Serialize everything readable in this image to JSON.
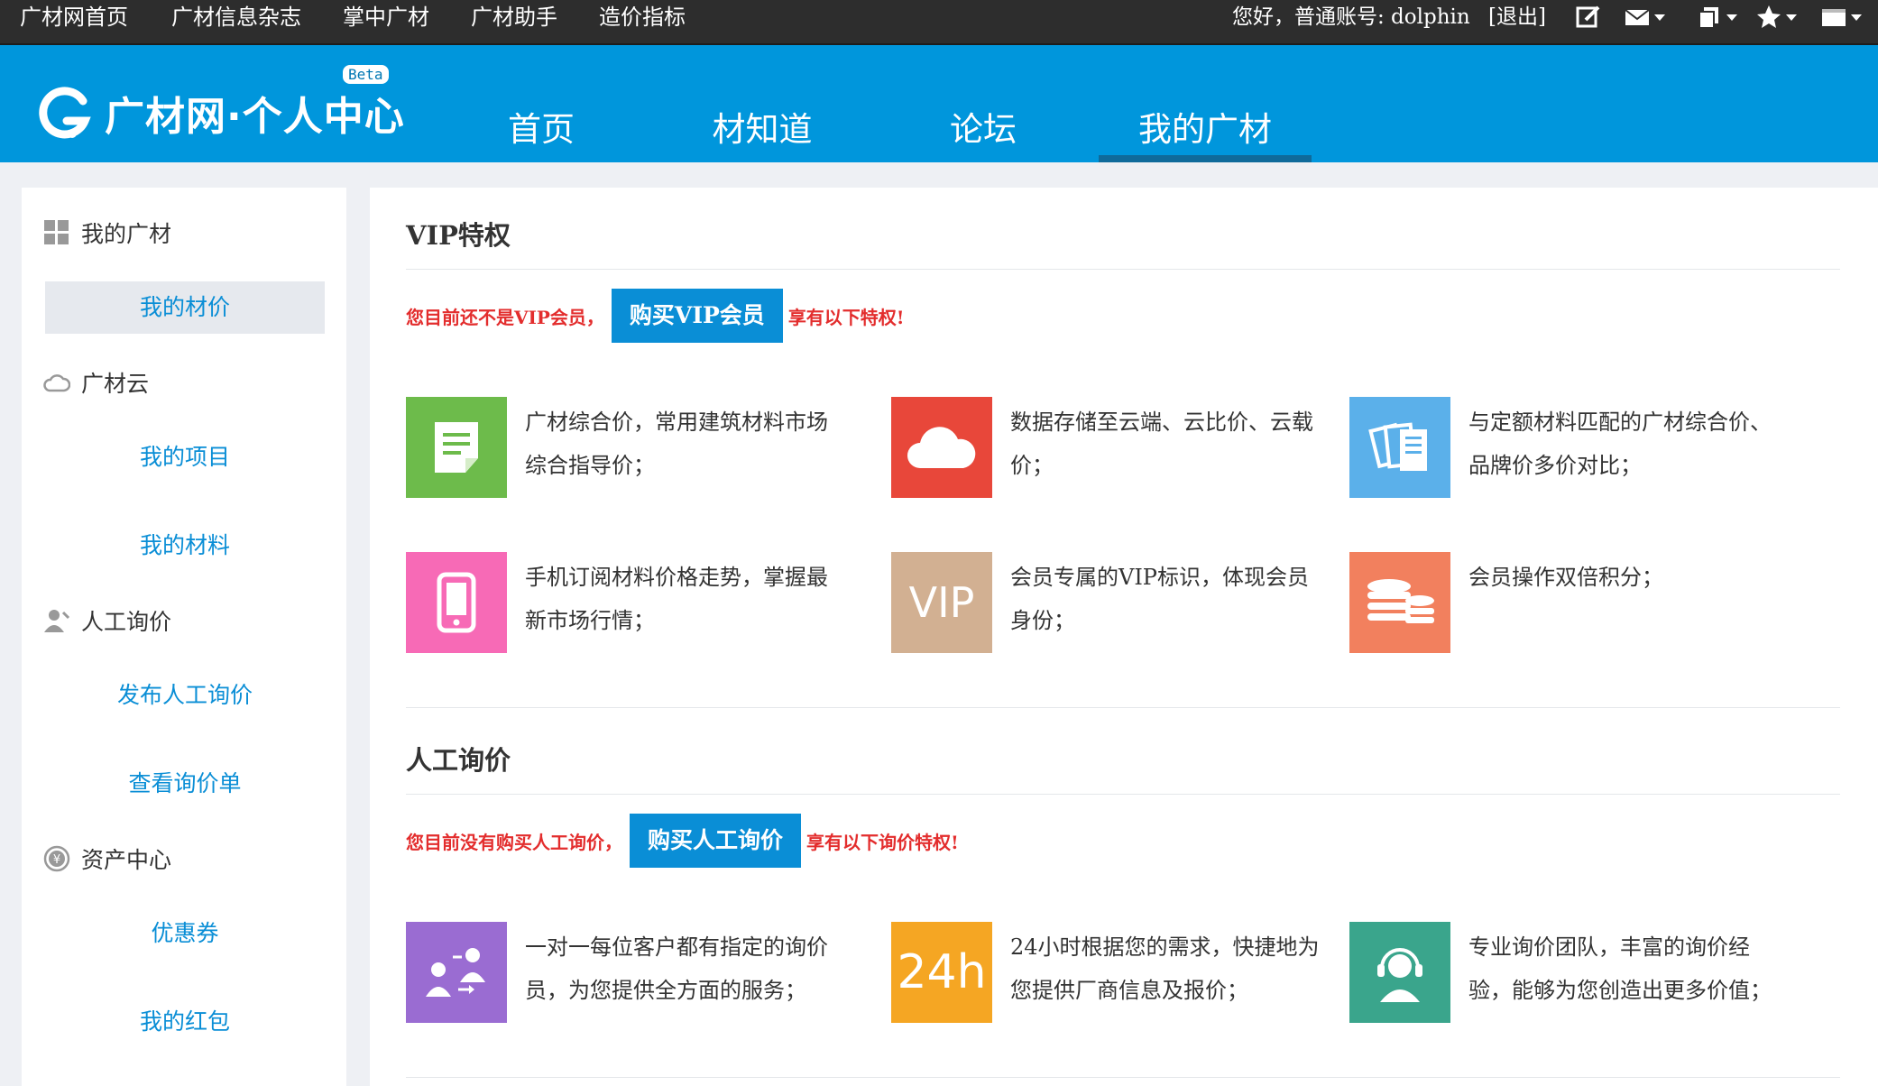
{
  "topbar": {
    "links": [
      "广材网首页",
      "广材信息杂志",
      "掌中广材",
      "广材助手",
      "造价指标"
    ],
    "greeting": "您好，普通账号: dolphin",
    "logout": "[退出]",
    "icons": [
      "edit-icon",
      "mail-icon",
      "copy-icon",
      "star-icon",
      "window-icon"
    ]
  },
  "header": {
    "logo_text": "广材网·个人中心",
    "beta": "Beta",
    "nav": [
      "首页",
      "材知道",
      "论坛",
      "我的广材"
    ],
    "active_nav": "我的广材"
  },
  "sidebar": {
    "my_guangcai": "我的广材",
    "my_price": "我的材价",
    "cloud": "广材云",
    "my_project": "我的项目",
    "my_material": "我的材料",
    "manual_inquiry": "人工询价",
    "publish_inquiry": "发布人工询价",
    "view_inquiry": "查看询价单",
    "asset_center": "资产中心",
    "coupon": "优惠券",
    "red_packet": "我的红包"
  },
  "vip": {
    "title": "VIP特权",
    "notice_prefix": "您目前还不是VIP会员，",
    "button": "购买VIP会员",
    "notice_suffix": "享有以下特权!",
    "features": [
      {
        "icon": "document-icon",
        "color": "#6dbb4b",
        "text": "广材综合价，常用建筑材料市场综合指导价；"
      },
      {
        "icon": "cloud-icon",
        "color": "#e8473a",
        "text": "数据存储至云端、云比价、云载价；"
      },
      {
        "icon": "files-icon",
        "color": "#5bb0ea",
        "text": "与定额材料匹配的广材综合价、品牌价多价对比；"
      },
      {
        "icon": "mobile-icon",
        "color": "#f76ab6",
        "text": "手机订阅材料价格走势，掌握最新市场行情；"
      },
      {
        "icon": "vip-icon",
        "color": "#d2b092",
        "label": "VIP",
        "text": "会员专属的VIP标识，体现会员身份；"
      },
      {
        "icon": "coins-icon",
        "color": "#f2805e",
        "text": "会员操作双倍积分；"
      }
    ]
  },
  "inquiry": {
    "title": "人工询价",
    "notice_prefix": "您目前没有购买人工询价，",
    "button": "购买人工询价",
    "notice_suffix": "享有以下询价特权!",
    "features": [
      {
        "icon": "exchange-icon",
        "color": "#9a6cd2",
        "text": "一对一每位客户都有指定的询价员，为您提供全方面的服务；"
      },
      {
        "icon": "24h-icon",
        "color": "#f5a623",
        "label": "24h",
        "text": "24小时根据您的需求，快捷地为您提供厂商信息及报价；"
      },
      {
        "icon": "headset-icon",
        "color": "#3aa58c",
        "text": "专业询价团队，丰富的询价经验，能够为您创造出更多价值；"
      }
    ]
  }
}
